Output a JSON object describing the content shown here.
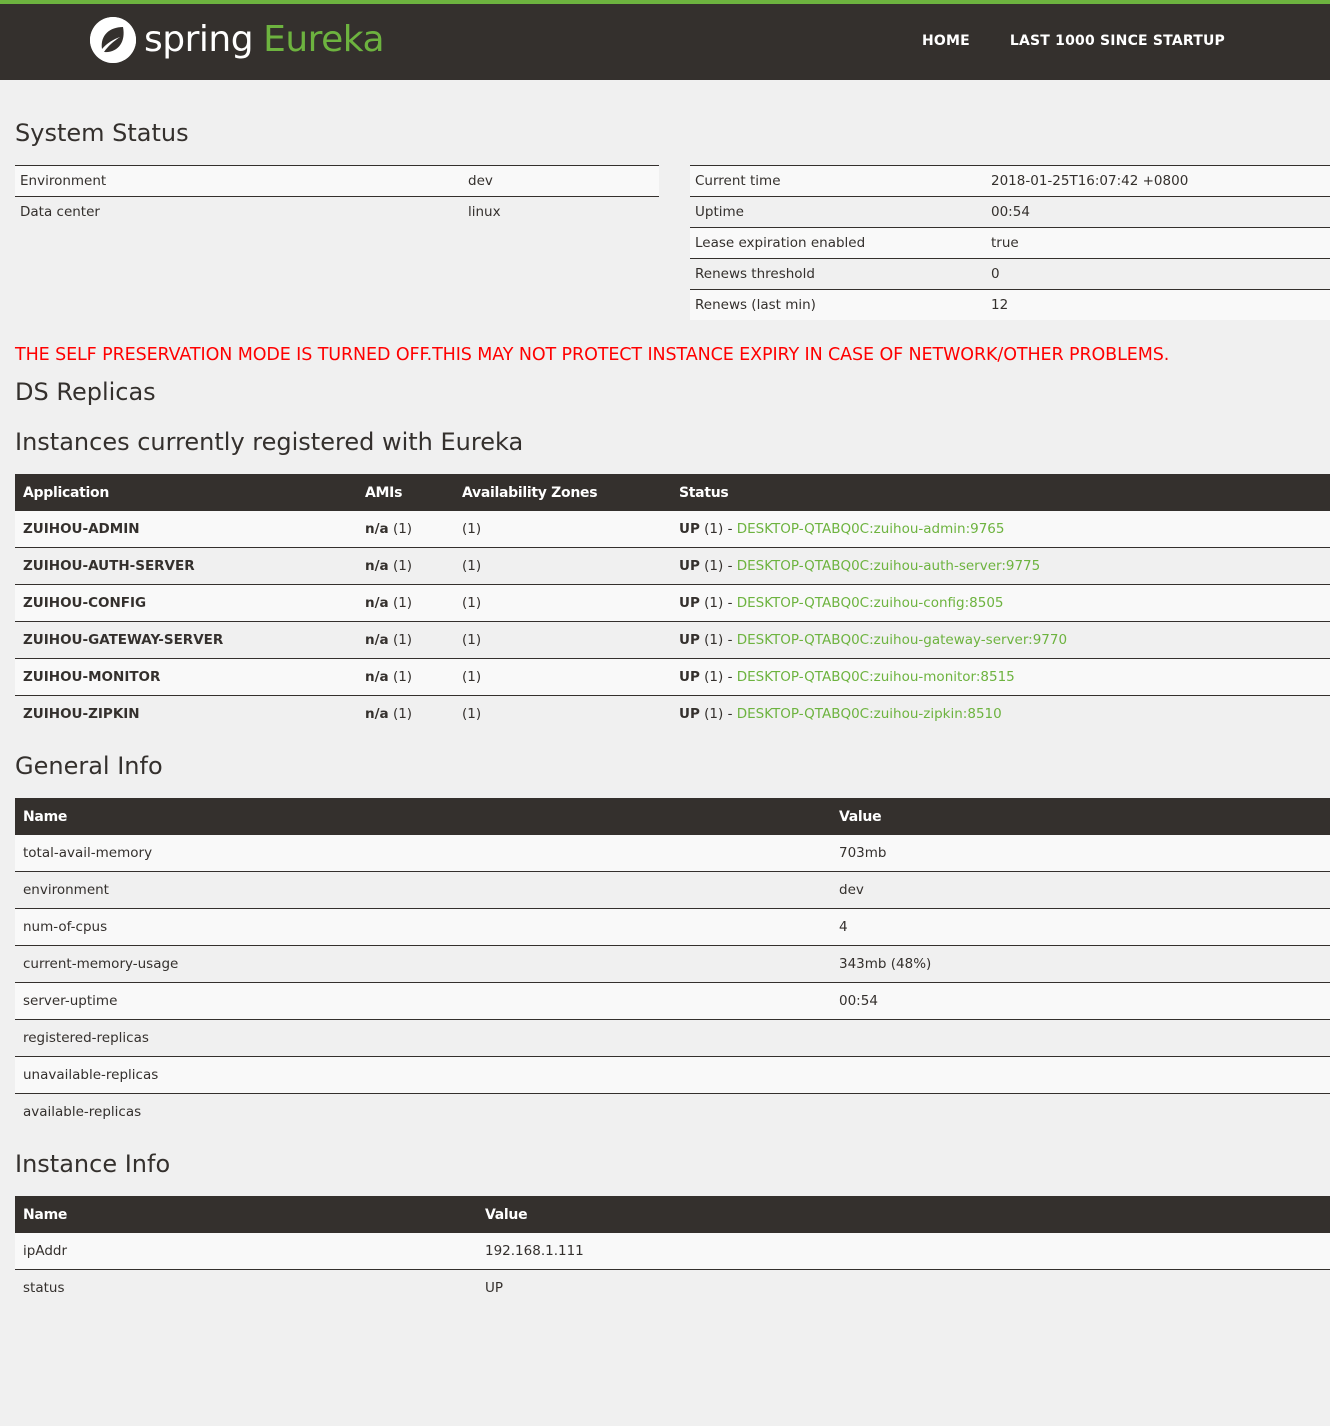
{
  "nav": {
    "brand_spring": "spring",
    "brand_eureka": "Eureka",
    "home": "HOME",
    "last1000": "LAST 1000 SINCE STARTUP"
  },
  "system_status": {
    "title": "System Status",
    "left": [
      {
        "label": "Environment",
        "value": "dev"
      },
      {
        "label": "Data center",
        "value": "linux"
      }
    ],
    "right": [
      {
        "label": "Current time",
        "value": "2018-01-25T16:07:42 +0800"
      },
      {
        "label": "Uptime",
        "value": "00:54"
      },
      {
        "label": "Lease expiration enabled",
        "value": "true"
      },
      {
        "label": "Renews threshold",
        "value": "0"
      },
      {
        "label": "Renews (last min)",
        "value": "12"
      }
    ]
  },
  "warning": "THE SELF PRESERVATION MODE IS TURNED OFF.THIS MAY NOT PROTECT INSTANCE EXPIRY IN CASE OF NETWORK/OTHER PROBLEMS.",
  "ds_replicas": {
    "title": "DS Replicas"
  },
  "instances": {
    "title": "Instances currently registered with Eureka",
    "headers": [
      "Application",
      "AMIs",
      "Availability Zones",
      "Status"
    ],
    "rows": [
      {
        "app": "ZUIHOU-ADMIN",
        "ami": "n/a",
        "ami_count": "(1)",
        "zones": "(1)",
        "status": "UP",
        "status_count": "(1) -",
        "link": "DESKTOP-QTABQ0C:zuihou-admin:9765"
      },
      {
        "app": "ZUIHOU-AUTH-SERVER",
        "ami": "n/a",
        "ami_count": "(1)",
        "zones": "(1)",
        "status": "UP",
        "status_count": "(1) -",
        "link": "DESKTOP-QTABQ0C:zuihou-auth-server:9775"
      },
      {
        "app": "ZUIHOU-CONFIG",
        "ami": "n/a",
        "ami_count": "(1)",
        "zones": "(1)",
        "status": "UP",
        "status_count": "(1) -",
        "link": "DESKTOP-QTABQ0C:zuihou-config:8505"
      },
      {
        "app": "ZUIHOU-GATEWAY-SERVER",
        "ami": "n/a",
        "ami_count": "(1)",
        "zones": "(1)",
        "status": "UP",
        "status_count": "(1) -",
        "link": "DESKTOP-QTABQ0C:zuihou-gateway-server:9770"
      },
      {
        "app": "ZUIHOU-MONITOR",
        "ami": "n/a",
        "ami_count": "(1)",
        "zones": "(1)",
        "status": "UP",
        "status_count": "(1) -",
        "link": "DESKTOP-QTABQ0C:zuihou-monitor:8515"
      },
      {
        "app": "ZUIHOU-ZIPKIN",
        "ami": "n/a",
        "ami_count": "(1)",
        "zones": "(1)",
        "status": "UP",
        "status_count": "(1) -",
        "link": "DESKTOP-QTABQ0C:zuihou-zipkin:8510"
      }
    ]
  },
  "general_info": {
    "title": "General Info",
    "headers": [
      "Name",
      "Value"
    ],
    "rows": [
      {
        "name": "total-avail-memory",
        "value": "703mb"
      },
      {
        "name": "environment",
        "value": "dev"
      },
      {
        "name": "num-of-cpus",
        "value": "4"
      },
      {
        "name": "current-memory-usage",
        "value": "343mb (48%)"
      },
      {
        "name": "server-uptime",
        "value": "00:54"
      },
      {
        "name": "registered-replicas",
        "value": ""
      },
      {
        "name": "unavailable-replicas",
        "value": ""
      },
      {
        "name": "available-replicas",
        "value": ""
      }
    ]
  },
  "instance_info": {
    "title": "Instance Info",
    "headers": [
      "Name",
      "Value"
    ],
    "rows": [
      {
        "name": "ipAddr",
        "value": "192.168.1.111"
      },
      {
        "name": "status",
        "value": "UP"
      }
    ]
  },
  "colors": {
    "accent": "#6db33f",
    "dark": "#34302d",
    "warning": "#ff0000"
  }
}
